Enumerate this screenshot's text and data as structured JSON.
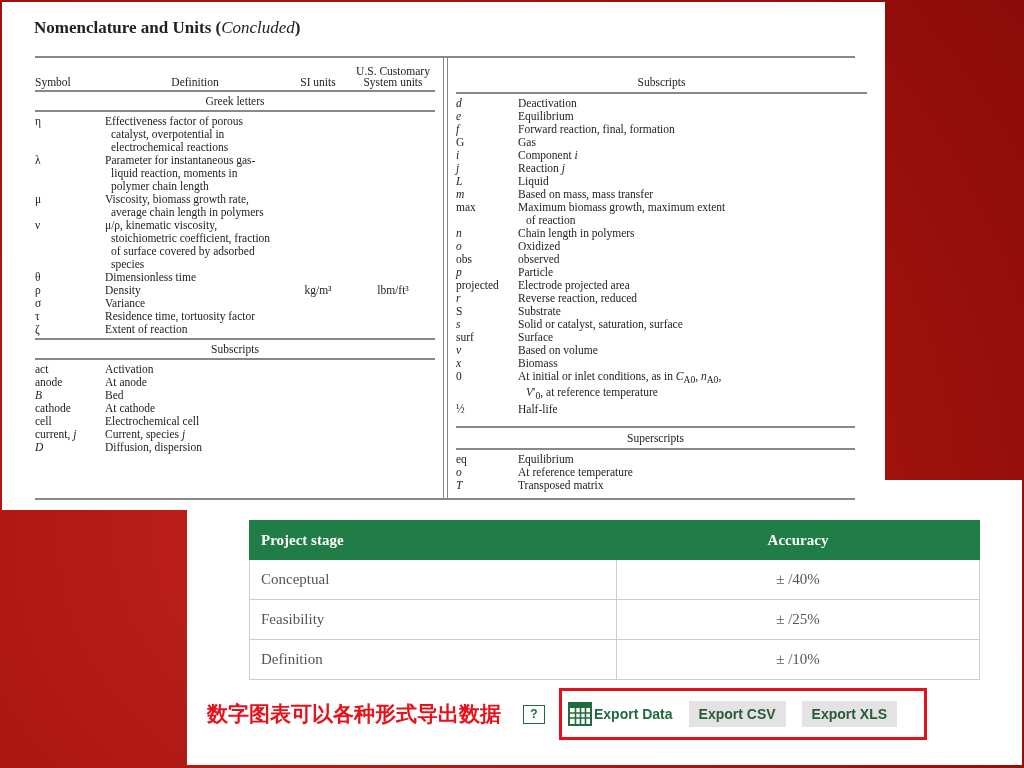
{
  "document": {
    "title": "Nomenclature and Units (*Concluded*)",
    "left_table": {
      "columns": [
        "Symbol",
        "Definition",
        "SI units",
        "U.S. Customary System units"
      ],
      "sections": [
        {
          "heading": "Greek letters",
          "rows": [
            {
              "symbol": "η",
              "definition": "Effectiveness factor of porous catalyst, overpotential in electrochemical reactions"
            },
            {
              "symbol": "λ",
              "definition": "Parameter for instantaneous gas-liquid reaction, moments in polymer chain length"
            },
            {
              "symbol": "μ",
              "definition": "Viscosity, biomass growth rate, average chain length in polymers"
            },
            {
              "symbol": "ν",
              "definition": "μ/ρ, kinematic viscosity, stoichiometric coefficient, fraction of surface covered by adsorbed species"
            },
            {
              "symbol": "θ",
              "definition": "Dimensionless time"
            },
            {
              "symbol": "ρ",
              "definition": "Density",
              "si": "kg/m³",
              "us": "lbm/ft³"
            },
            {
              "symbol": "σ",
              "definition": "Variance"
            },
            {
              "symbol": "τ",
              "definition": "Residence time, tortuosity factor"
            },
            {
              "symbol": "ζ",
              "definition": "Extent of reaction"
            }
          ]
        },
        {
          "heading": "Subscripts",
          "rows": [
            {
              "symbol": "act",
              "definition": "Activation"
            },
            {
              "symbol": "anode",
              "definition": "At anode"
            },
            {
              "symbol": "B",
              "italic": true,
              "definition": "Bed"
            },
            {
              "symbol": "cathode",
              "definition": "At cathode"
            },
            {
              "symbol": "cell",
              "definition": "Electrochemical cell"
            },
            {
              "symbol": "current, *j*",
              "definition": "Current, species *j*"
            },
            {
              "symbol": "D",
              "italic": true,
              "definition": "Diffusion, dispersion"
            }
          ]
        }
      ]
    },
    "right_table": {
      "sections": [
        {
          "heading": "Subscripts",
          "rows": [
            {
              "symbol": "d",
              "italic": true,
              "definition": "Deactivation"
            },
            {
              "symbol": "e",
              "italic": true,
              "definition": "Equilibrium"
            },
            {
              "symbol": "f",
              "italic": true,
              "definition": "Forward reaction, final, formation"
            },
            {
              "symbol": "G",
              "definition": "Gas"
            },
            {
              "symbol": "i",
              "italic": true,
              "definition": "Component *i*"
            },
            {
              "symbol": "j",
              "italic": true,
              "definition": "Reaction *j*"
            },
            {
              "symbol": "L",
              "italic": true,
              "definition": "Liquid"
            },
            {
              "symbol": "m",
              "italic": true,
              "definition": "Based on mass, mass transfer"
            },
            {
              "symbol": "max",
              "definition": "Maximum biomass growth, maximum extent of reaction"
            },
            {
              "symbol": "n",
              "italic": true,
              "definition": "Chain length in polymers"
            },
            {
              "symbol": "o",
              "italic": true,
              "definition": "Oxidized"
            },
            {
              "symbol": "obs",
              "definition": "observed"
            },
            {
              "symbol": "p",
              "italic": true,
              "definition": "Particle"
            },
            {
              "symbol": "projected",
              "definition": "Electrode projected area"
            },
            {
              "symbol": "r",
              "italic": true,
              "definition": "Reverse reaction, reduced"
            },
            {
              "symbol": "S",
              "definition": "Substrate"
            },
            {
              "symbol": "s",
              "italic": true,
              "definition": "Solid or catalyst, saturation, surface"
            },
            {
              "symbol": "surf",
              "definition": "Surface"
            },
            {
              "symbol": "v",
              "italic": true,
              "definition": "Based on volume"
            },
            {
              "symbol": "x",
              "italic": true,
              "definition": "Biomass"
            },
            {
              "symbol": "0",
              "definition": "At initial or inlet conditions, as in *C*$_{A0}$, *n*$_{A0}$, *V*′$_{0}$, at reference temperature"
            },
            {
              "symbol": "½",
              "definition": "Half-life"
            }
          ]
        },
        {
          "heading": "Superscripts",
          "rows": [
            {
              "symbol": "eq",
              "definition": "Equilibrium"
            },
            {
              "symbol": "o",
              "italic": true,
              "definition": "At reference temperature"
            },
            {
              "symbol": "T",
              "italic": true,
              "definition": "Transposed matrix"
            }
          ]
        }
      ]
    }
  },
  "web_table": {
    "columns": [
      "Project stage",
      "Accuracy"
    ],
    "rows": [
      [
        "Conceptual",
        "± /40%"
      ],
      [
        "Feasibility",
        "± /25%"
      ],
      [
        "Definition",
        "± /10%"
      ]
    ]
  },
  "annotation": "数字图表可以各种形式导出数据",
  "help_button": "?",
  "export": {
    "label": "Export Data",
    "buttons": [
      "Export CSV",
      "Export XLS"
    ]
  }
}
